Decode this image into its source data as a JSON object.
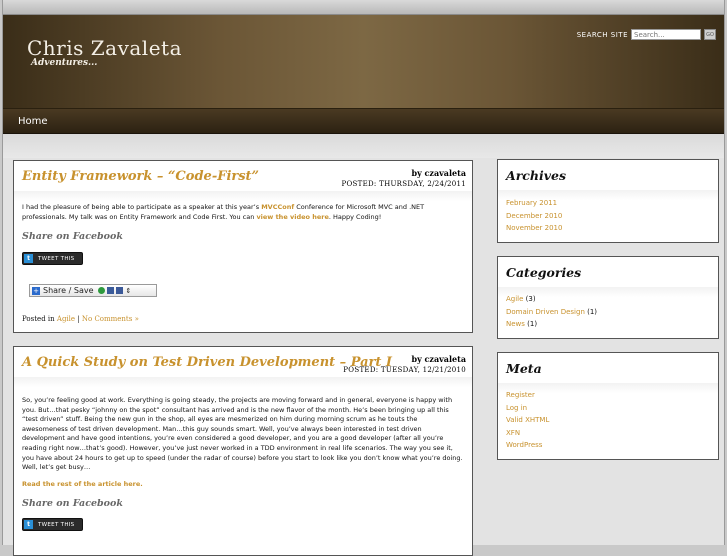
{
  "site": {
    "title": "Chris Zavaleta",
    "tagline": "Adventures..."
  },
  "search": {
    "label": "SEARCH SITE",
    "placeholder": "Search...",
    "button": "GO"
  },
  "nav": {
    "items": [
      {
        "label": "Home"
      }
    ]
  },
  "posts": [
    {
      "title": "Entity Framework – “Code-First”",
      "author": "by czavaleta",
      "date": "POSTED: THURSDAY, 2/24/2011",
      "body_part1": "I had the pleasure of being able to participate as a speaker at this year’s ",
      "body_link1": "MVCConf",
      "body_part2": " Conference for Microsoft MVC and .NET professionals. My talk was on Entity Framework and Code First. You can ",
      "body_link2": "view the video here",
      "body_part3": ".  Happy Coding!",
      "share_facebook": "Share on Facebook",
      "tweet_label": "TWEET THIS",
      "share_save_label": "Share / Save",
      "posted_in_label": "Posted in",
      "category": "Agile",
      "separator": "|",
      "comments": "No Comments »"
    },
    {
      "title": "A Quick Study on Test Driven Development – Part I",
      "author": "by czavaleta",
      "date": "POSTED: TUESDAY, 12/21/2010",
      "body": "So, you’re feeling good at work. Everything is going steady, the projects are moving forward and in general, everyone is happy with you. But…that pesky “johnny on the spot” consultant has arrived and is the new flavor of the month. He’s been bringing up all this “test driven” stuff. Being the new gun in the shop, all eyes are mesmerized on him during morning scrum as he touts the awesomeness of test driven development. Man…this guy sounds smart. Well, you’ve always been interested in test driven development and have good intentions, you’re even considered a good developer, and you are a good developer (after all you’re reading right now…that’s good). However, you’ve just never worked in a TDD environment in real life scenarios. The way you see it, you have about 24 hours to get up to speed (under the radar of course) before you start to look like you don’t know what you’re doing. Well, let’s get busy…",
      "read_more": "Read the rest of the article here.",
      "share_facebook": "Share on Facebook",
      "tweet_label": "TWEET THIS"
    }
  ],
  "sidebar": {
    "archives": {
      "title": "Archives",
      "items": [
        "February 2011",
        "December 2010",
        "November 2010"
      ]
    },
    "categories": {
      "title": "Categories",
      "items": [
        {
          "name": "Agile",
          "count": "(3)"
        },
        {
          "name": "Domain Driven Design",
          "count": "(1)"
        },
        {
          "name": "News",
          "count": "(1)"
        }
      ]
    },
    "meta": {
      "title": "Meta",
      "items": [
        "Register",
        "Log in",
        "Valid XHTML",
        "XFN",
        "WordPress"
      ]
    }
  },
  "colors": {
    "accent": "#c8922e",
    "header_brown": "#6b5636",
    "nav_dark": "#2c2212"
  }
}
